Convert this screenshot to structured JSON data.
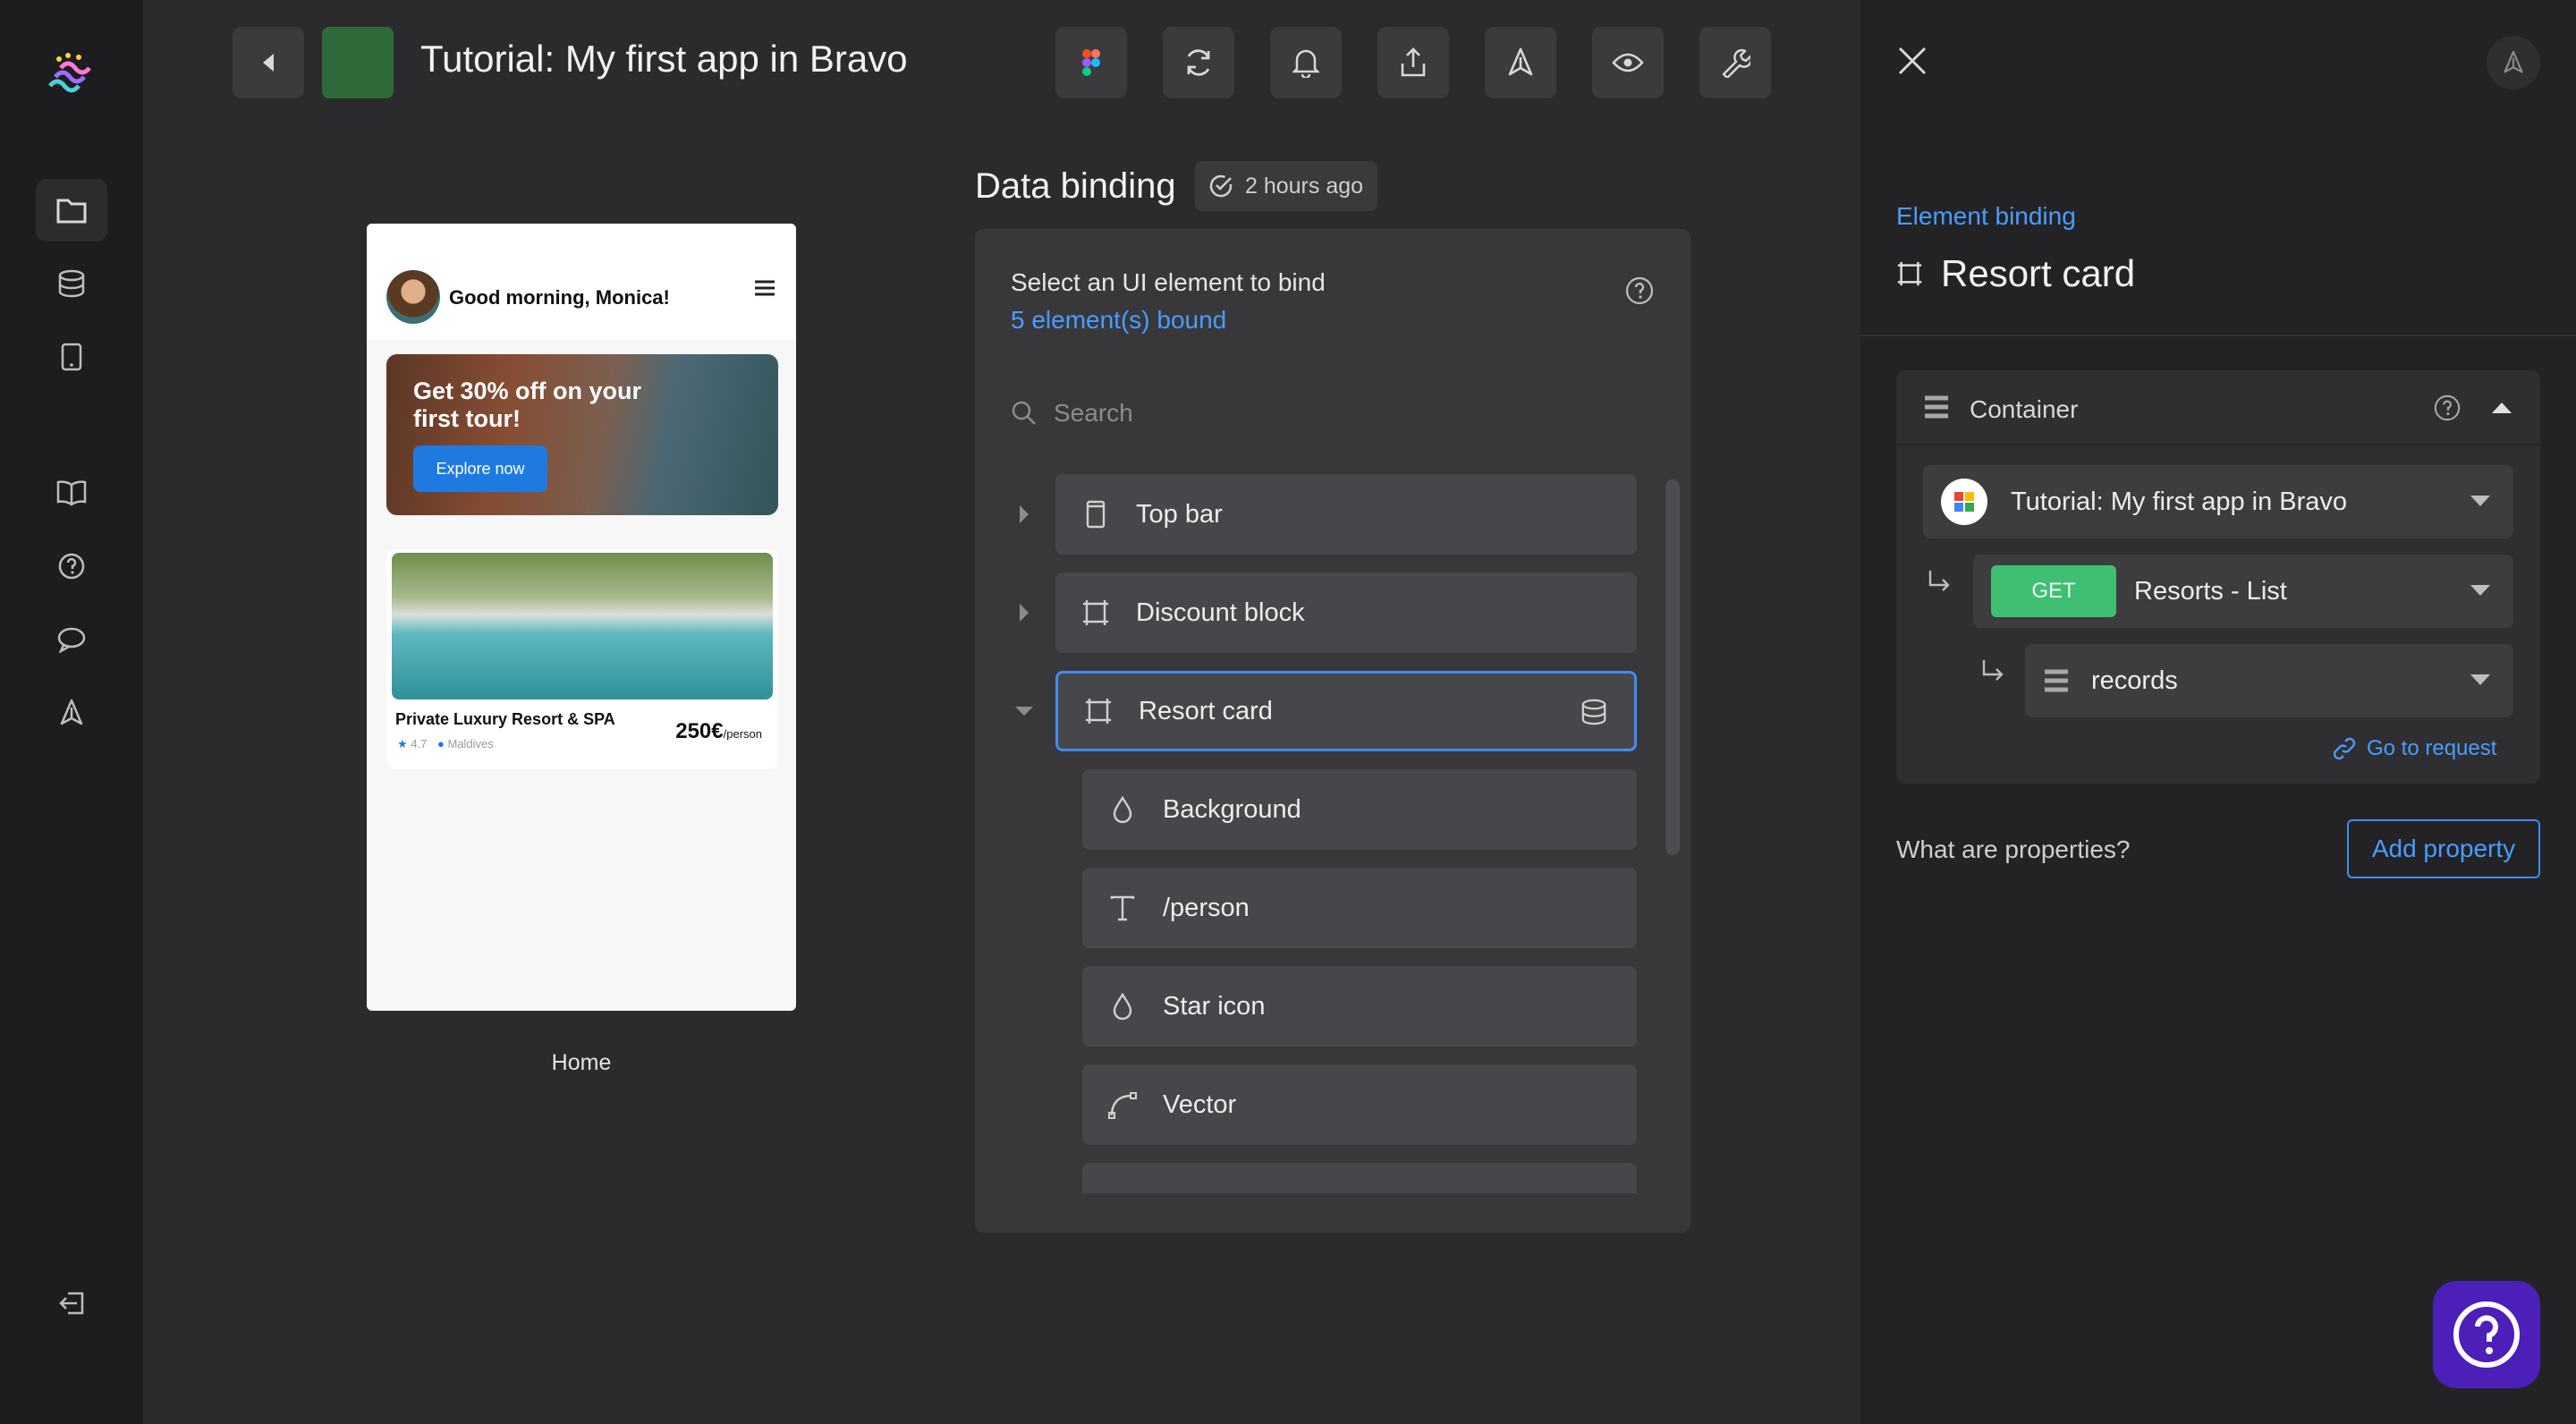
{
  "header": {
    "title": "Tutorial: My first app in Bravo",
    "toolbar": [
      "figma-icon",
      "refresh-icon",
      "bell-icon",
      "share-icon",
      "publish-icon",
      "preview-icon",
      "wrench-icon"
    ]
  },
  "sidebar": {
    "items": [
      "folder-icon",
      "database-icon",
      "phone-icon",
      "book-icon",
      "help-icon",
      "chat-icon",
      "rocket-icon"
    ],
    "bottom": "logout-icon"
  },
  "preview": {
    "greeting": "Good morning, Monica!",
    "banner_text": "Get 30% off on your first tour!",
    "banner_button": "Explore now",
    "card_name": "Private Luxury Resort & SPA",
    "card_rating": "4.7",
    "card_location": "Maldives",
    "card_price": "250€",
    "card_price_unit": "/person",
    "screen_name": "Home"
  },
  "data_binding": {
    "title": "Data binding",
    "saved": "2 hours ago",
    "select_prompt": "Select an UI element to bind",
    "bound_count": "5 element(s) bound",
    "search_placeholder": "Search",
    "tree": [
      {
        "label": "Top bar",
        "icon": "mobile-icon",
        "expanded": false
      },
      {
        "label": "Discount block",
        "icon": "frame-icon",
        "expanded": false
      },
      {
        "label": "Resort card",
        "icon": "frame-icon",
        "expanded": true,
        "selected": true
      },
      {
        "label": "Background",
        "icon": "fill-icon"
      },
      {
        "label": "/person",
        "icon": "text-icon"
      },
      {
        "label": "Star icon",
        "icon": "fill-icon"
      },
      {
        "label": "Vector",
        "icon": "vector-icon"
      }
    ]
  },
  "element_binding": {
    "link": "Element binding",
    "title": "Resort card",
    "container_label": "Container",
    "source": "Tutorial: My first app in Bravo",
    "method": "GET",
    "request": "Resorts - List",
    "path": "records",
    "go_to_request": "Go to request",
    "properties_question": "What are properties?",
    "add_property": "Add property"
  },
  "colors": {
    "accent": "#3f8cf0",
    "link": "#4a9cff",
    "get_badge": "#3fbf72",
    "help_button": "#4b1fb8"
  }
}
